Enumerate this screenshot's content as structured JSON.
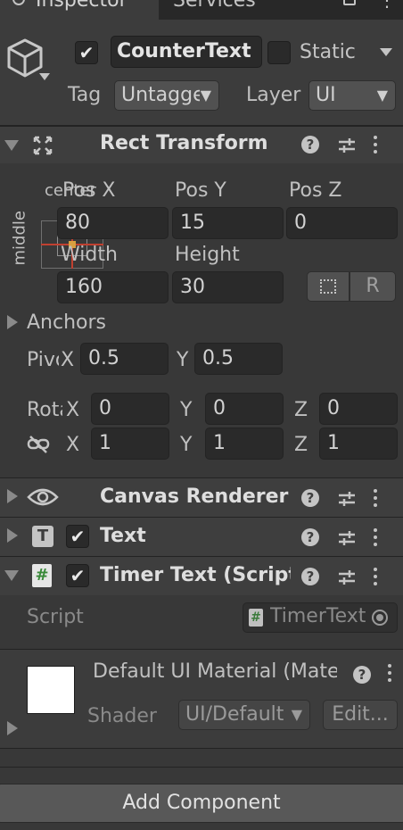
{
  "tabs": {
    "inspector": "Inspector",
    "services": "Services"
  },
  "object": {
    "name": "CounterText",
    "active": true,
    "static_label": "Static",
    "static": false,
    "tag_label": "Tag",
    "tag_value": "Untagged",
    "layer_label": "Layer",
    "layer_value": "UI"
  },
  "rect_transform": {
    "title": "Rect Transform",
    "anchor_h": "center",
    "anchor_v": "middle",
    "pos_x_label": "Pos X",
    "pos_y_label": "Pos Y",
    "pos_z_label": "Pos Z",
    "pos_x": "80",
    "pos_y": "15",
    "pos_z": "0",
    "width_label": "Width",
    "height_label": "Height",
    "width": "160",
    "height": "30",
    "r_button": "R",
    "anchors_label": "Anchors",
    "pivot_label": "Pivot",
    "pivot_x_label": "X",
    "pivot_y_label": "Y",
    "pivot_x": "0.5",
    "pivot_y": "0.5",
    "rotation_label": "Rotation",
    "rot_x_label": "X",
    "rot_y_label": "Y",
    "rot_z_label": "Z",
    "rot_x": "0",
    "rot_y": "0",
    "rot_z": "0",
    "scale_x_label": "X",
    "scale_y_label": "Y",
    "scale_z_label": "Z",
    "scale_x": "1",
    "scale_y": "1",
    "scale_z": "1"
  },
  "canvas_renderer": {
    "title": "Canvas Renderer"
  },
  "text_component": {
    "title": "Text",
    "enabled": true
  },
  "timer_text": {
    "title": "Timer Text (Script)",
    "enabled": true,
    "script_label": "Script",
    "script_value": "TimerText"
  },
  "material": {
    "title": "Default UI Material (Material)",
    "shader_label": "Shader",
    "shader_value": "UI/Default",
    "edit_button": "Edit..."
  },
  "add_component": "Add Component"
}
